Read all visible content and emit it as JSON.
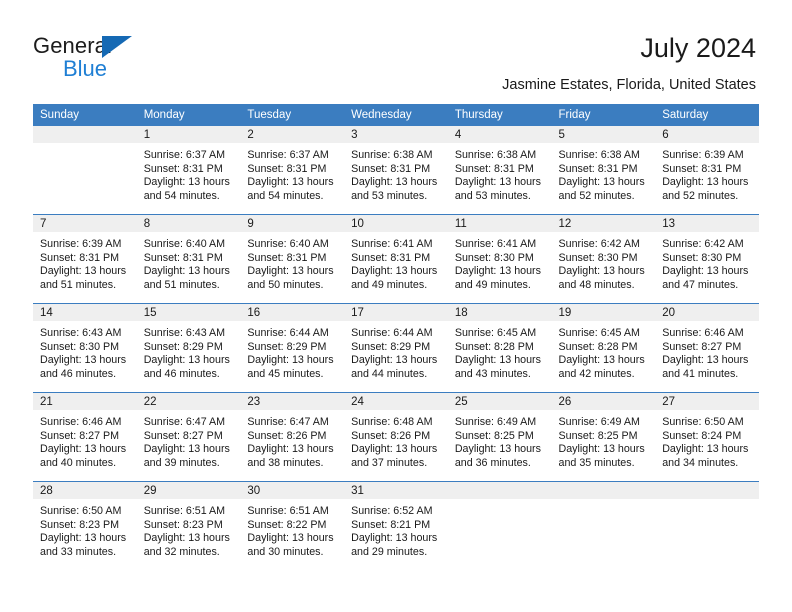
{
  "brand": {
    "word_one": "General",
    "word_two": "Blue",
    "triangle_icon": "triangle-icon",
    "accent_blue": "#1f7fd4",
    "header_blue": "#3b7dc0"
  },
  "header": {
    "title": "July 2024",
    "subtitle": "Jasmine Estates, Florida, United States"
  },
  "calendar": {
    "weekday_headers": [
      "Sunday",
      "Monday",
      "Tuesday",
      "Wednesday",
      "Thursday",
      "Friday",
      "Saturday"
    ],
    "labels": {
      "sunrise": "Sunrise:",
      "sunset": "Sunset:",
      "daylight": "Daylight:"
    },
    "weeks": [
      [
        {
          "day": "",
          "empty": true
        },
        {
          "day": "1",
          "sunrise": "Sunrise: 6:37 AM",
          "sunset": "Sunset: 8:31 PM",
          "daylight_line1": "Daylight: 13 hours",
          "daylight_line2": "and 54 minutes."
        },
        {
          "day": "2",
          "sunrise": "Sunrise: 6:37 AM",
          "sunset": "Sunset: 8:31 PM",
          "daylight_line1": "Daylight: 13 hours",
          "daylight_line2": "and 54 minutes."
        },
        {
          "day": "3",
          "sunrise": "Sunrise: 6:38 AM",
          "sunset": "Sunset: 8:31 PM",
          "daylight_line1": "Daylight: 13 hours",
          "daylight_line2": "and 53 minutes."
        },
        {
          "day": "4",
          "sunrise": "Sunrise: 6:38 AM",
          "sunset": "Sunset: 8:31 PM",
          "daylight_line1": "Daylight: 13 hours",
          "daylight_line2": "and 53 minutes."
        },
        {
          "day": "5",
          "sunrise": "Sunrise: 6:38 AM",
          "sunset": "Sunset: 8:31 PM",
          "daylight_line1": "Daylight: 13 hours",
          "daylight_line2": "and 52 minutes."
        },
        {
          "day": "6",
          "sunrise": "Sunrise: 6:39 AM",
          "sunset": "Sunset: 8:31 PM",
          "daylight_line1": "Daylight: 13 hours",
          "daylight_line2": "and 52 minutes."
        }
      ],
      [
        {
          "day": "7",
          "sunrise": "Sunrise: 6:39 AM",
          "sunset": "Sunset: 8:31 PM",
          "daylight_line1": "Daylight: 13 hours",
          "daylight_line2": "and 51 minutes."
        },
        {
          "day": "8",
          "sunrise": "Sunrise: 6:40 AM",
          "sunset": "Sunset: 8:31 PM",
          "daylight_line1": "Daylight: 13 hours",
          "daylight_line2": "and 51 minutes."
        },
        {
          "day": "9",
          "sunrise": "Sunrise: 6:40 AM",
          "sunset": "Sunset: 8:31 PM",
          "daylight_line1": "Daylight: 13 hours",
          "daylight_line2": "and 50 minutes."
        },
        {
          "day": "10",
          "sunrise": "Sunrise: 6:41 AM",
          "sunset": "Sunset: 8:31 PM",
          "daylight_line1": "Daylight: 13 hours",
          "daylight_line2": "and 49 minutes."
        },
        {
          "day": "11",
          "sunrise": "Sunrise: 6:41 AM",
          "sunset": "Sunset: 8:30 PM",
          "daylight_line1": "Daylight: 13 hours",
          "daylight_line2": "and 49 minutes."
        },
        {
          "day": "12",
          "sunrise": "Sunrise: 6:42 AM",
          "sunset": "Sunset: 8:30 PM",
          "daylight_line1": "Daylight: 13 hours",
          "daylight_line2": "and 48 minutes."
        },
        {
          "day": "13",
          "sunrise": "Sunrise: 6:42 AM",
          "sunset": "Sunset: 8:30 PM",
          "daylight_line1": "Daylight: 13 hours",
          "daylight_line2": "and 47 minutes."
        }
      ],
      [
        {
          "day": "14",
          "sunrise": "Sunrise: 6:43 AM",
          "sunset": "Sunset: 8:30 PM",
          "daylight_line1": "Daylight: 13 hours",
          "daylight_line2": "and 46 minutes."
        },
        {
          "day": "15",
          "sunrise": "Sunrise: 6:43 AM",
          "sunset": "Sunset: 8:29 PM",
          "daylight_line1": "Daylight: 13 hours",
          "daylight_line2": "and 46 minutes."
        },
        {
          "day": "16",
          "sunrise": "Sunrise: 6:44 AM",
          "sunset": "Sunset: 8:29 PM",
          "daylight_line1": "Daylight: 13 hours",
          "daylight_line2": "and 45 minutes."
        },
        {
          "day": "17",
          "sunrise": "Sunrise: 6:44 AM",
          "sunset": "Sunset: 8:29 PM",
          "daylight_line1": "Daylight: 13 hours",
          "daylight_line2": "and 44 minutes."
        },
        {
          "day": "18",
          "sunrise": "Sunrise: 6:45 AM",
          "sunset": "Sunset: 8:28 PM",
          "daylight_line1": "Daylight: 13 hours",
          "daylight_line2": "and 43 minutes."
        },
        {
          "day": "19",
          "sunrise": "Sunrise: 6:45 AM",
          "sunset": "Sunset: 8:28 PM",
          "daylight_line1": "Daylight: 13 hours",
          "daylight_line2": "and 42 minutes."
        },
        {
          "day": "20",
          "sunrise": "Sunrise: 6:46 AM",
          "sunset": "Sunset: 8:27 PM",
          "daylight_line1": "Daylight: 13 hours",
          "daylight_line2": "and 41 minutes."
        }
      ],
      [
        {
          "day": "21",
          "sunrise": "Sunrise: 6:46 AM",
          "sunset": "Sunset: 8:27 PM",
          "daylight_line1": "Daylight: 13 hours",
          "daylight_line2": "and 40 minutes."
        },
        {
          "day": "22",
          "sunrise": "Sunrise: 6:47 AM",
          "sunset": "Sunset: 8:27 PM",
          "daylight_line1": "Daylight: 13 hours",
          "daylight_line2": "and 39 minutes."
        },
        {
          "day": "23",
          "sunrise": "Sunrise: 6:47 AM",
          "sunset": "Sunset: 8:26 PM",
          "daylight_line1": "Daylight: 13 hours",
          "daylight_line2": "and 38 minutes."
        },
        {
          "day": "24",
          "sunrise": "Sunrise: 6:48 AM",
          "sunset": "Sunset: 8:26 PM",
          "daylight_line1": "Daylight: 13 hours",
          "daylight_line2": "and 37 minutes."
        },
        {
          "day": "25",
          "sunrise": "Sunrise: 6:49 AM",
          "sunset": "Sunset: 8:25 PM",
          "daylight_line1": "Daylight: 13 hours",
          "daylight_line2": "and 36 minutes."
        },
        {
          "day": "26",
          "sunrise": "Sunrise: 6:49 AM",
          "sunset": "Sunset: 8:25 PM",
          "daylight_line1": "Daylight: 13 hours",
          "daylight_line2": "and 35 minutes."
        },
        {
          "day": "27",
          "sunrise": "Sunrise: 6:50 AM",
          "sunset": "Sunset: 8:24 PM",
          "daylight_line1": "Daylight: 13 hours",
          "daylight_line2": "and 34 minutes."
        }
      ],
      [
        {
          "day": "28",
          "sunrise": "Sunrise: 6:50 AM",
          "sunset": "Sunset: 8:23 PM",
          "daylight_line1": "Daylight: 13 hours",
          "daylight_line2": "and 33 minutes."
        },
        {
          "day": "29",
          "sunrise": "Sunrise: 6:51 AM",
          "sunset": "Sunset: 8:23 PM",
          "daylight_line1": "Daylight: 13 hours",
          "daylight_line2": "and 32 minutes."
        },
        {
          "day": "30",
          "sunrise": "Sunrise: 6:51 AM",
          "sunset": "Sunset: 8:22 PM",
          "daylight_line1": "Daylight: 13 hours",
          "daylight_line2": "and 30 minutes."
        },
        {
          "day": "31",
          "sunrise": "Sunrise: 6:52 AM",
          "sunset": "Sunset: 8:21 PM",
          "daylight_line1": "Daylight: 13 hours",
          "daylight_line2": "and 29 minutes."
        },
        {
          "day": "",
          "empty": true
        },
        {
          "day": "",
          "empty": true
        },
        {
          "day": "",
          "empty": true
        }
      ]
    ]
  }
}
